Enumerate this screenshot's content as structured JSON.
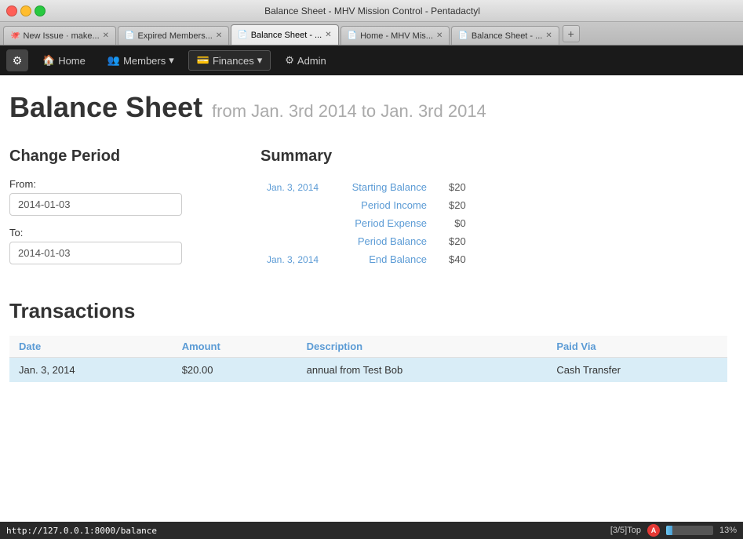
{
  "browser": {
    "title": "Balance Sheet - MHV Mission Control - Pentadactyl",
    "tabs": [
      {
        "id": "tab1",
        "label": "New Issue · make...",
        "active": false,
        "icon": "🐙"
      },
      {
        "id": "tab2",
        "label": "Expired Members...",
        "active": false,
        "icon": "📄"
      },
      {
        "id": "tab3",
        "label": "Balance Sheet - ...",
        "active": true,
        "icon": "📄"
      },
      {
        "id": "tab4",
        "label": "Home - MHV Mis...",
        "active": false,
        "icon": "📄"
      },
      {
        "id": "tab5",
        "label": "Balance Sheet - ...",
        "active": false,
        "icon": "📄"
      }
    ]
  },
  "nav": {
    "logo": "⚙",
    "items": [
      {
        "id": "home",
        "label": "Home",
        "icon": "🏠",
        "active": false
      },
      {
        "id": "members",
        "label": "Members",
        "icon": "👥",
        "active": false,
        "dropdown": true
      },
      {
        "id": "finances",
        "label": "Finances",
        "icon": "💳",
        "active": true,
        "dropdown": true
      },
      {
        "id": "admin",
        "label": "Admin",
        "icon": "⚙",
        "active": false
      }
    ]
  },
  "page": {
    "title": "Balance Sheet",
    "subtitle": "from Jan. 3rd 2014 to Jan. 3rd 2014"
  },
  "change_period": {
    "heading": "Change Period",
    "from_label": "From:",
    "from_value": "2014-01-03",
    "to_label": "To:",
    "to_value": "2014-01-03"
  },
  "summary": {
    "heading": "Summary",
    "rows": [
      {
        "date": "Jan. 3, 2014",
        "label": "Starting Balance",
        "value": "$20"
      },
      {
        "date": "",
        "label": "Period Income",
        "value": "$20"
      },
      {
        "date": "",
        "label": "Period Expense",
        "value": "$0"
      },
      {
        "date": "",
        "label": "Period Balance",
        "value": "$20"
      },
      {
        "date": "Jan. 3, 2014",
        "label": "End Balance",
        "value": "$40"
      }
    ]
  },
  "transactions": {
    "heading": "Transactions",
    "columns": [
      {
        "id": "date",
        "label": "Date"
      },
      {
        "id": "amount",
        "label": "Amount"
      },
      {
        "id": "description",
        "label": "Description"
      },
      {
        "id": "paid_via",
        "label": "Paid Via"
      }
    ],
    "rows": [
      {
        "date": "Jan. 3, 2014",
        "amount": "$20.00",
        "description": "annual from Test Bob",
        "paid_via": "Cash Transfer"
      }
    ]
  },
  "status_bar": {
    "url": "http://127.0.0.1:8000/balance",
    "position": "[3/5]Top",
    "progress": 13,
    "progress_label": "13%"
  }
}
